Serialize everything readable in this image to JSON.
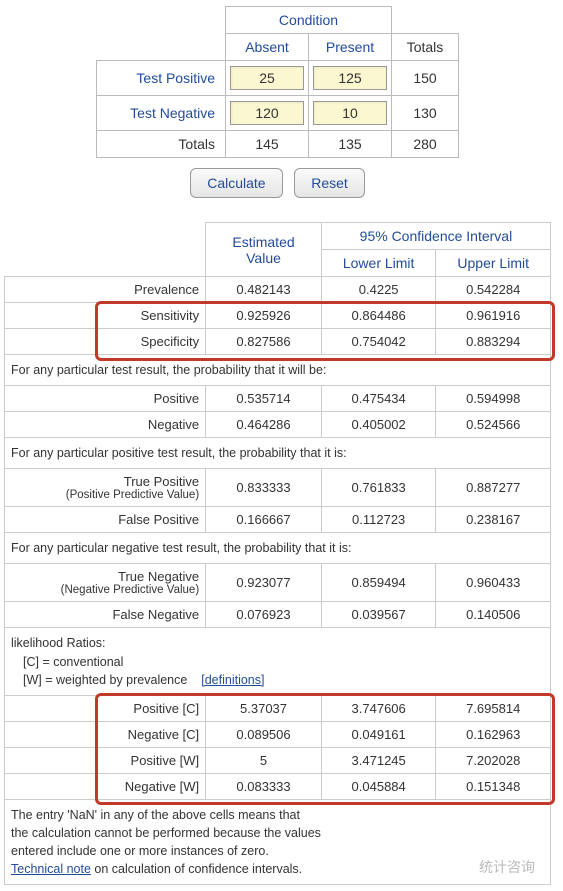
{
  "contingency": {
    "condition_header": "Condition",
    "cols": {
      "absent": "Absent",
      "present": "Present",
      "totals": "Totals"
    },
    "rows": {
      "test_positive": "Test Positive",
      "test_negative": "Test Negative",
      "totals": "Totals"
    },
    "values": {
      "absent_positive": "25",
      "present_positive": "125",
      "total_positive": "150",
      "absent_negative": "120",
      "present_negative": "10",
      "total_negative": "130",
      "absent_total": "145",
      "present_total": "135",
      "grand_total": "280"
    }
  },
  "buttons": {
    "calculate": "Calculate",
    "reset": "Reset"
  },
  "results": {
    "headers": {
      "estimated": "Estimated Value",
      "ci": "95% Confidence Interval",
      "lower": "Lower Limit",
      "upper": "Upper Limit"
    },
    "prevalence": {
      "label": "Prevalence",
      "est": "0.482143",
      "lo": "0.4225",
      "hi": "0.542284"
    },
    "sensitivity": {
      "label": "Sensitivity",
      "est": "0.925926",
      "lo": "0.864486",
      "hi": "0.961916"
    },
    "specificity": {
      "label": "Specificity",
      "est": "0.827586",
      "lo": "0.754042",
      "hi": "0.883294"
    },
    "note_anytest": "For any particular test result, the probability that it will be:",
    "positive": {
      "label": "Positive",
      "est": "0.535714",
      "lo": "0.475434",
      "hi": "0.594998"
    },
    "negative": {
      "label": "Negative",
      "est": "0.464286",
      "lo": "0.405002",
      "hi": "0.524566"
    },
    "note_anypos": "For any particular positive test result, the probability that it is:",
    "tpos": {
      "label": "True Positive",
      "sub": "(Positive Predictive Value)",
      "est": "0.833333",
      "lo": "0.761833",
      "hi": "0.887277"
    },
    "fpos": {
      "label": "False Positive",
      "est": "0.166667",
      "lo": "0.112723",
      "hi": "0.238167"
    },
    "note_anyneg": "For any particular negative test result, the probability that it is:",
    "tneg": {
      "label": "True Negative",
      "sub": "(Negative Predictive Value)",
      "est": "0.923077",
      "lo": "0.859494",
      "hi": "0.960433"
    },
    "fneg": {
      "label": "False Negative",
      "est": "0.076923",
      "lo": "0.039567",
      "hi": "0.140506"
    },
    "lr": {
      "intro": "likelihood Ratios:",
      "c": "[C] = conventional",
      "w": "[W] = weighted by prevalence",
      "def_link": "[definitions]",
      "posC": {
        "label": "Positive [C]",
        "est": "5.37037",
        "lo": "3.747606",
        "hi": "7.695814"
      },
      "negC": {
        "label": "Negative [C]",
        "est": "0.089506",
        "lo": "0.049161",
        "hi": "0.162963"
      },
      "posW": {
        "label": "Positive [W]",
        "est": "5",
        "lo": "3.471245",
        "hi": "7.202028"
      },
      "negW": {
        "label": "Negative [W]",
        "est": "0.083333",
        "lo": "0.045884",
        "hi": "0.151348"
      }
    },
    "footer": {
      "l1": "The entry 'NaN' in any of the above cells means that",
      "l2": "the calculation cannot be performed because the values",
      "l3": "entered include one or more instances of zero.",
      "link": "Technical note",
      "l4": " on calculation of confidence intervals."
    }
  },
  "watermark": "统计咨询"
}
